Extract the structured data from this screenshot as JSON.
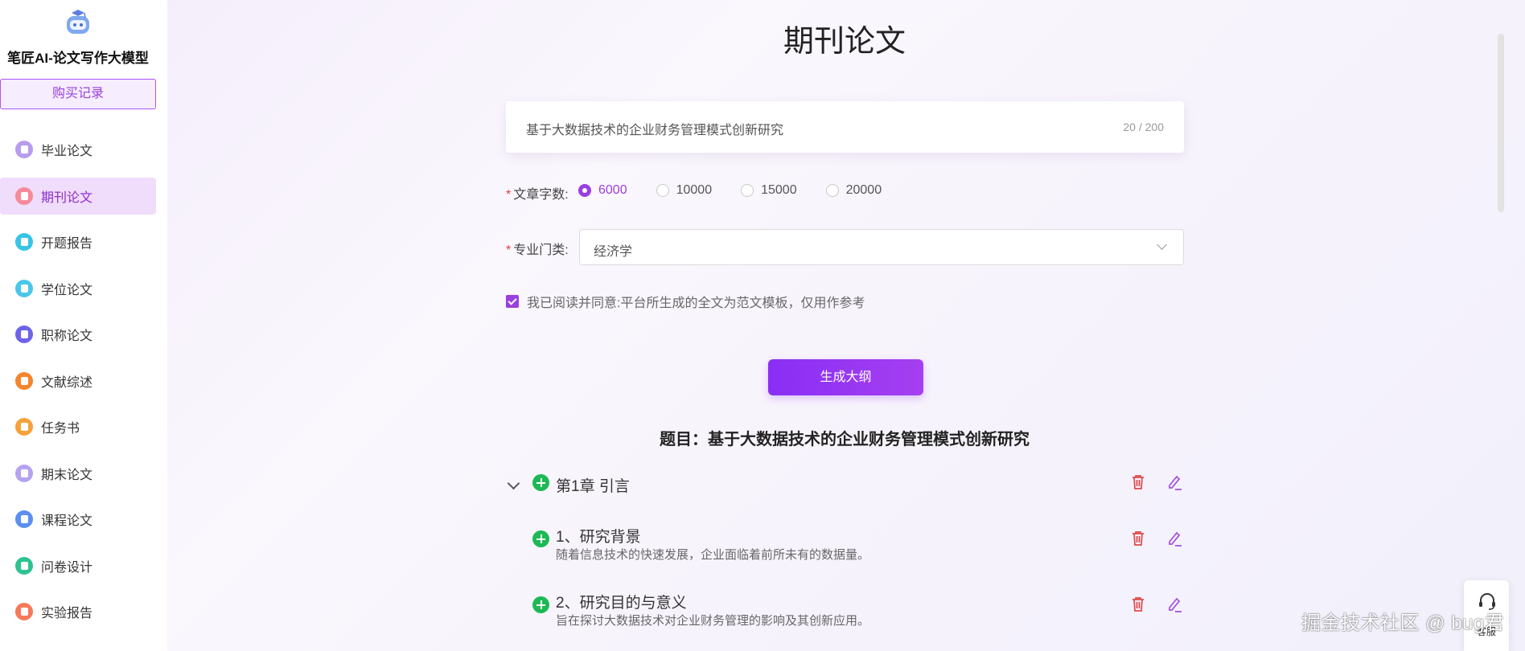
{
  "sidebar": {
    "brand": "笔匠AI-论文写作大模型",
    "purchase_label": "购买记录",
    "items": [
      {
        "label": "毕业论文",
        "color": "#b89cf0"
      },
      {
        "label": "期刊论文",
        "color": "#f58a9a"
      },
      {
        "label": "开题报告",
        "color": "#38c4e6"
      },
      {
        "label": "学位论文",
        "color": "#4ac6e8"
      },
      {
        "label": "职称论文",
        "color": "#6e64e8"
      },
      {
        "label": "文献综述",
        "color": "#f3852e"
      },
      {
        "label": "任务书",
        "color": "#f5a23a"
      },
      {
        "label": "期末论文",
        "color": "#b6a3f0"
      },
      {
        "label": "课程论文",
        "color": "#5b8ff0"
      },
      {
        "label": "问卷设计",
        "color": "#2ec290"
      },
      {
        "label": "实验报告",
        "color": "#f57a5a"
      }
    ]
  },
  "main": {
    "title": "期刊论文",
    "topic": {
      "value": "基于大数据技术的企业财务管理模式创新研究",
      "count": "20 / 200"
    },
    "word_count": {
      "label": "文章字数:",
      "options": [
        "6000",
        "10000",
        "15000",
        "20000"
      ],
      "selected": "6000"
    },
    "major": {
      "label": "专业门类:",
      "value": "经济学"
    },
    "agreement": "我已阅读并同意:平台所生成的全文为范文模板，仅用作参考",
    "generate_label": "生成大纲",
    "outline_title": "题目：基于大数据技术的企业财务管理模式创新研究",
    "chapter": {
      "title": "第1章 引言"
    },
    "sections": [
      {
        "title": "1、研究背景",
        "desc": "随着信息技术的快速发展，企业面临着前所未有的数据量。"
      },
      {
        "title": "2、研究目的与意义",
        "desc": "旨在探讨大数据技术对企业财务管理的影响及其创新应用。"
      }
    ]
  },
  "service_label": "客服",
  "watermark": "掘金技术社区 @ bug君",
  "colors": {
    "accent": "#9b3fe0",
    "add": "#1db954",
    "delete": "#e04848",
    "edit": "#a54ee0"
  }
}
